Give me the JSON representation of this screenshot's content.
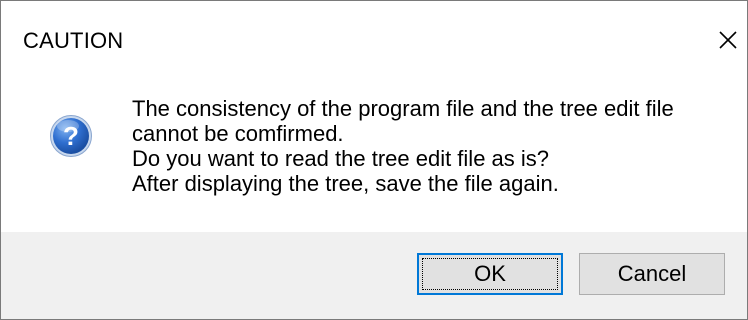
{
  "dialog": {
    "title": "CAUTION",
    "close_icon": "close-icon",
    "message_icon": "question-icon",
    "message_lines": [
      "The consistency of the program file and the tree edit file",
      "cannot be comfirmed.",
      "Do you want to read the tree edit file as is?",
      "After displaying the tree, save the file again."
    ],
    "buttons": {
      "ok_label": "OK",
      "cancel_label": "Cancel"
    }
  },
  "colors": {
    "footer_background": "#f0f0f0",
    "button_background": "#e1e1e1",
    "focus_border": "#0078d7",
    "icon_blue": "#2f6fd0"
  }
}
